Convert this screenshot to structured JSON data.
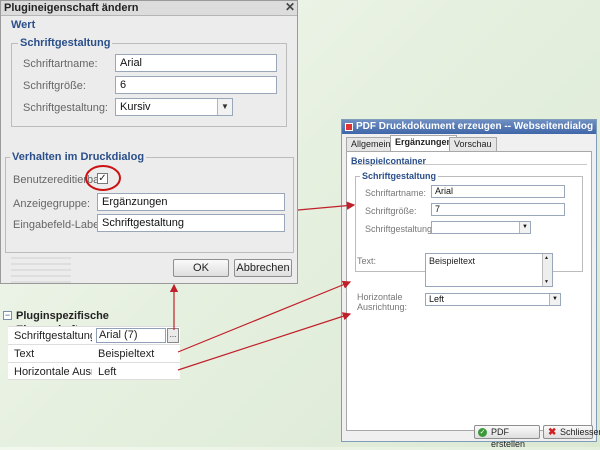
{
  "dialog1": {
    "title": "Plugineigenschaft ändern",
    "section_wert": "Wert",
    "group_schrift": "Schriftgestaltung",
    "label_name": "Schriftartname:",
    "value_name": "Arial",
    "label_size": "Schriftgröße:",
    "value_size": "6",
    "label_style": "Schriftgestaltung:",
    "value_style": "Kursiv",
    "section_verhalten": "Verhalten im Druckdialog",
    "label_editable": "Benutzereditierbar:",
    "editable_checked": "✓",
    "label_group": "Anzeigegruppe:",
    "value_group": "Ergänzungen",
    "label_field": "Eingabefeld-Label:",
    "value_field": "Schriftgestaltung",
    "ok": "OK",
    "cancel": "Abbrechen"
  },
  "property_grid": {
    "title": "Pluginspezifische Eigenschaften",
    "toggle": "−",
    "rows": [
      {
        "name": "Schriftgestaltung",
        "value": "Arial (7)"
      },
      {
        "name": "Text",
        "value": "Beispieltext"
      },
      {
        "name": "Horizontale Ausrichtung",
        "value": "Left"
      }
    ],
    "ellipsis": "..."
  },
  "dialog2": {
    "title": "PDF Druckdokument erzeugen -- Webseitendialog",
    "tabs": [
      "Allgemein",
      "Ergänzungen",
      "Vorschau"
    ],
    "group_container": "Beispielcontainer",
    "group_schrift": "Schriftgestaltung",
    "label_name": "Schriftartname:",
    "value_name": "Arial",
    "label_size": "Schriftgröße:",
    "value_size": "7",
    "label_style": "Schriftgestaltung:",
    "value_style": "",
    "label_text": "Text:",
    "value_text": "Beispieltext",
    "label_align": "Horizontale Ausrichtung:",
    "value_align": "Left",
    "btn_create": "PDF erstellen",
    "btn_close": "Schliessen"
  },
  "colors": {
    "arrow": "#c0202a",
    "highlight_circle": "#cc1111",
    "accent": "#2a4f8a"
  }
}
